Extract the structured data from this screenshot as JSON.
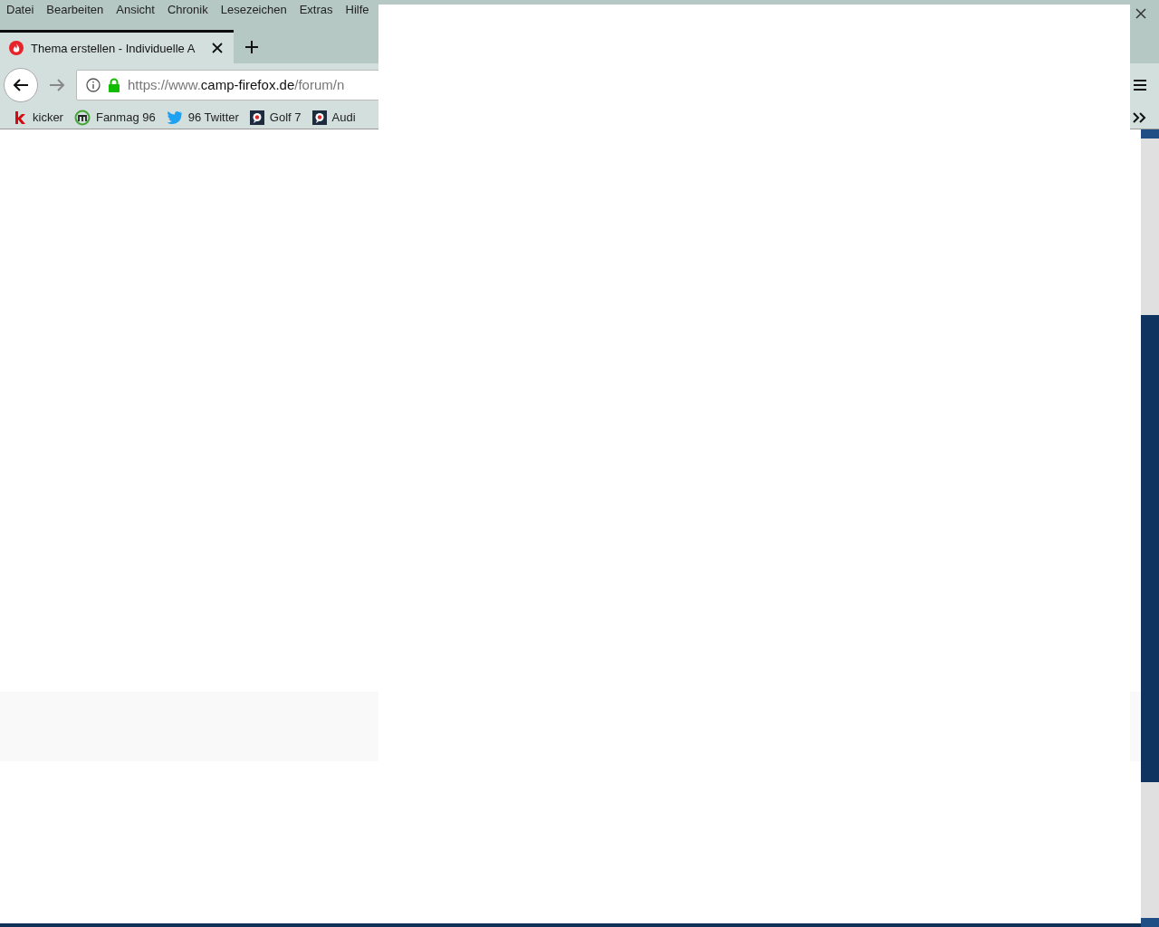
{
  "menu_bar": {
    "items": [
      {
        "label": "Datei"
      },
      {
        "label": "Bearbeiten"
      },
      {
        "label": "Ansicht"
      },
      {
        "label": "Chronik"
      },
      {
        "label": "Lesezeichen"
      },
      {
        "label": "Extras"
      },
      {
        "label": "Hilfe"
      }
    ]
  },
  "tabs": [
    {
      "title": "Thema erstellen - Individuelle A",
      "selected": true
    }
  ],
  "address_bar": {
    "scheme": "https://www.",
    "domain": "camp-firefox.de",
    "path": "/forum/n"
  },
  "bookmarks": [
    {
      "label": "kicker",
      "kind": "kicker"
    },
    {
      "label": "Fanmag 96",
      "kind": "fanmag"
    },
    {
      "label": "96 Twitter",
      "kind": "bird"
    },
    {
      "label": "Golf 7",
      "kind": "chat"
    },
    {
      "label": "Audi",
      "kind": "chat"
    }
  ],
  "overlay": {
    "kind": "blank"
  }
}
